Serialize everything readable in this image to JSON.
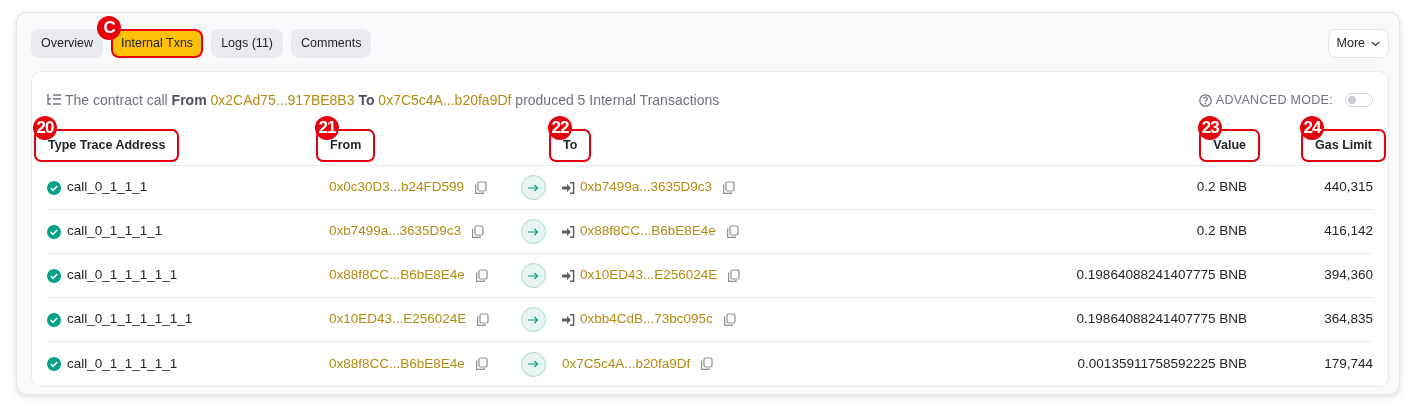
{
  "tabs": [
    {
      "label": "Overview",
      "selected": false
    },
    {
      "label": "Internal Txns",
      "selected": true,
      "marker": "C"
    },
    {
      "label": "Logs (11)",
      "selected": false
    },
    {
      "label": "Comments",
      "selected": false
    }
  ],
  "more_button": "More",
  "summary": {
    "prefix": "The contract call",
    "from_label": "From",
    "from": "0x2CAd75...917BE8B3",
    "to_label": "To",
    "to": "0x7C5c4A...b20fa9Df",
    "suffix": "produced 5 Internal Transactions"
  },
  "advanced_mode": {
    "label": "ADVANCED MODE:",
    "on": false
  },
  "columns": [
    {
      "label": "Type Trace Address",
      "marker": "20"
    },
    {
      "label": "From",
      "marker": "21"
    },
    {
      "label": "To",
      "marker": "22"
    },
    {
      "label": "Value",
      "marker": "23"
    },
    {
      "label": "Gas Limit",
      "marker": "24"
    }
  ],
  "rows": [
    {
      "type": "call_0_1_1_1",
      "from": "0x0c30D3...b24FD599",
      "to": "0xb7499a...3635D9c3",
      "to_contract": true,
      "value": "0.2 BNB",
      "gas_limit": "440,315"
    },
    {
      "type": "call_0_1_1_1_1",
      "from": "0xb7499a...3635D9c3",
      "to": "0x88f8CC...B6bE8E4e",
      "to_contract": true,
      "value": "0.2 BNB",
      "gas_limit": "416,142"
    },
    {
      "type": "call_0_1_1_1_1_1",
      "from": "0x88f8CC...B6bE8E4e",
      "to": "0x10ED43...E256024E",
      "to_contract": true,
      "value": "0.19864088241407775 BNB",
      "gas_limit": "394,360"
    },
    {
      "type": "call_0_1_1_1_1_1_1",
      "from": "0x10ED43...E256024E",
      "to": "0xbb4CdB...73bc095c",
      "to_contract": true,
      "value": "0.19864088241407775 BNB",
      "gas_limit": "364,835"
    },
    {
      "type": "call_0_1_1_1_1_1",
      "from": "0x88f8CC...B6bE8E4e",
      "to": "0x7C5c4A...b20fa9Df",
      "to_contract": false,
      "value": "0.00135911758592225 BNB",
      "gas_limit": "179,744"
    }
  ]
}
